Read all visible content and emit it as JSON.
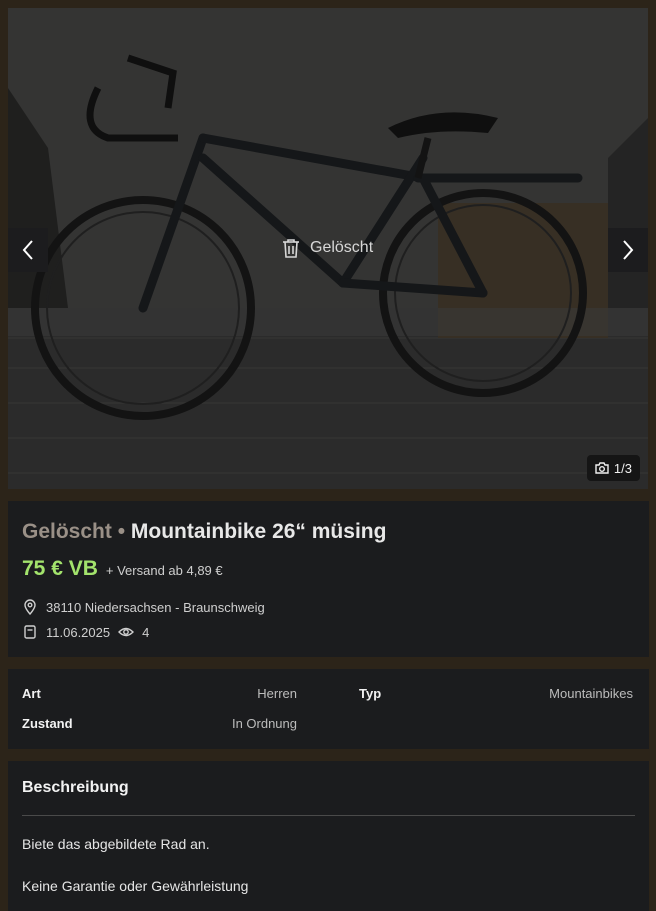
{
  "gallery": {
    "deleted_label": "Gelöscht",
    "counter": "1/3",
    "icons": {
      "prev": "chevron-left-icon",
      "next": "chevron-right-icon",
      "trash": "trash-icon",
      "camera": "camera-icon"
    }
  },
  "listing": {
    "status": "Gelöscht",
    "separator": "•",
    "title": "Mountainbike 26“ müsing",
    "price": "75 € VB",
    "shipping": "+ Versand ab 4,89 €",
    "location": "38110 Niedersachsen - Braunschweig",
    "date": "11.06.2025",
    "views": "4",
    "price_color": "#a3e36c"
  },
  "attributes": [
    {
      "label": "Art",
      "value": "Herren"
    },
    {
      "label": "Typ",
      "value": "Mountainbikes"
    },
    {
      "label": "Zustand",
      "value": "In Ordnung"
    }
  ],
  "description": {
    "heading": "Beschreibung",
    "lines": [
      "Biete das abgebildete Rad an.",
      "Keine Garantie oder Gewährleistung"
    ]
  }
}
